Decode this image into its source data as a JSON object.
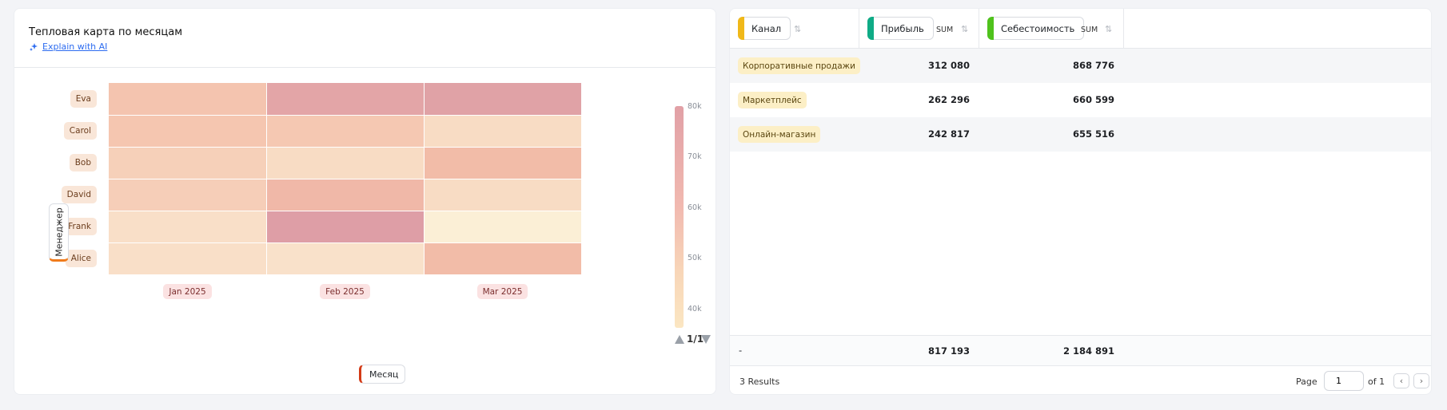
{
  "heatmap": {
    "title": "Тепловая карта по месяцам",
    "explain_label": "Explain with AI",
    "y_axis_pill": "Менеджер",
    "x_axis_pill": "Месяц",
    "legend_ticks": [
      "80k",
      "70k",
      "60k",
      "50k",
      "40k"
    ],
    "pager": "1/1"
  },
  "chart_data": {
    "type": "heatmap",
    "rows": [
      "Eva",
      "Carol",
      "Bob",
      "David",
      "Frank",
      "Alice"
    ],
    "columns": [
      "Jan 2025",
      "Feb 2025",
      "Mar 2025"
    ],
    "color_scale": {
      "min": 36000,
      "max": 82000,
      "min_color": "#fcf3da",
      "max_color": "#db9aa6"
    },
    "values": [
      [
        60000,
        76000,
        78000
      ],
      [
        59000,
        58000,
        48000
      ],
      [
        54000,
        48000,
        64000
      ],
      [
        55000,
        66000,
        48000
      ],
      [
        46000,
        80000,
        38000
      ],
      [
        46000,
        45000,
        64000
      ]
    ],
    "legend_ticks": [
      "80k",
      "70k",
      "60k",
      "50k",
      "40k"
    ]
  },
  "table": {
    "columns": [
      {
        "label": "Канал",
        "color": "#f0b819"
      },
      {
        "label": "Прибыль",
        "agg": "SUM",
        "color": "#0fab86"
      },
      {
        "label": "Себестоимость",
        "agg": "SUM",
        "color": "#4fc21c"
      }
    ],
    "rows": [
      {
        "channel": "Корпоративные продажи",
        "profit": "312 080",
        "cost": "868 776"
      },
      {
        "channel": "Маркетплейс",
        "profit": "262 296",
        "cost": "660 599"
      },
      {
        "channel": "Онлайн-магазин",
        "profit": "242 817",
        "cost": "655 516"
      }
    ],
    "totals": {
      "label": "-",
      "profit": "817 193",
      "cost": "2 184 891"
    },
    "results": "3 Results",
    "page_label": "Page",
    "page_value": "1",
    "of_label": "of 1"
  }
}
